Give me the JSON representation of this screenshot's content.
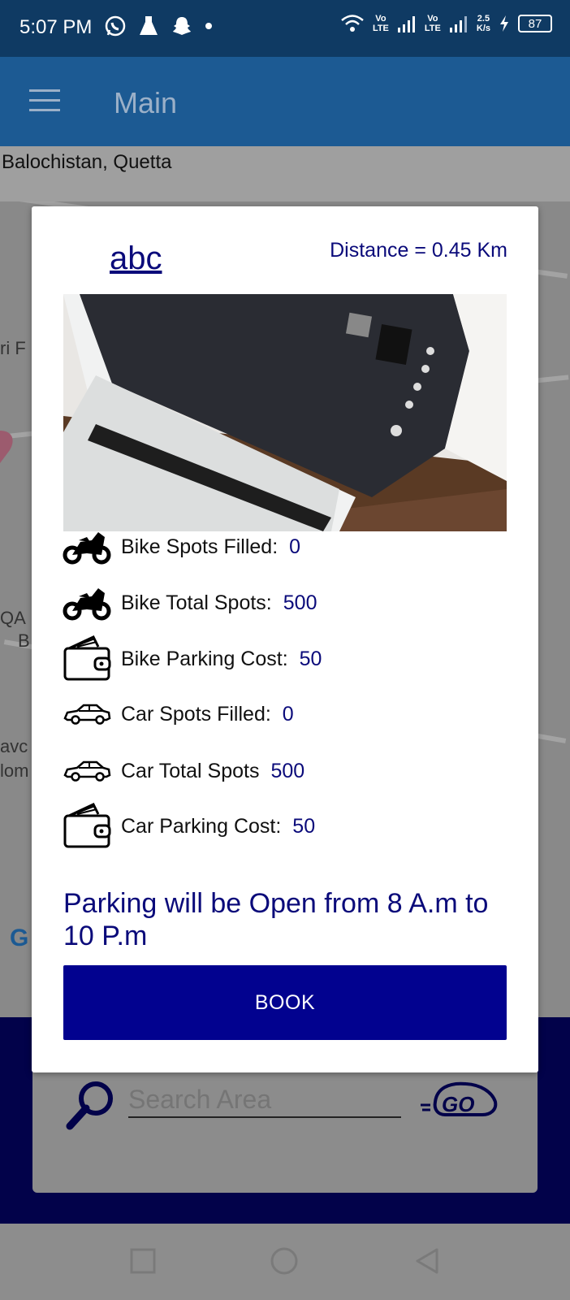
{
  "status_bar": {
    "time": "5:07 PM",
    "net_speed_top": "2.5",
    "net_speed_bottom": "K/s",
    "volte_1": "Vo\nLTE",
    "volte_2": "Vo\nLTE",
    "battery": "87"
  },
  "app_bar": {
    "title": "Main"
  },
  "location": {
    "text": "Balochistan, Quetta"
  },
  "map": {
    "fragments": [
      "ri F",
      "QA",
      "B",
      "avc",
      "lom"
    ]
  },
  "modal": {
    "place_name": "abc",
    "distance": "Distance = 0.45 Km",
    "rows": [
      {
        "icon": "motorbike-icon",
        "label": "Bike Spots Filled:",
        "value": "0"
      },
      {
        "icon": "motorbike-icon",
        "label": "Bike Total Spots:",
        "value": "500"
      },
      {
        "icon": "wallet-icon",
        "label": "Bike Parking Cost:",
        "value": "50"
      },
      {
        "icon": "car-icon",
        "label": "Car Spots Filled:",
        "value": "0"
      },
      {
        "icon": "car-icon",
        "label": "Car Total Spots",
        "value": "500"
      },
      {
        "icon": "wallet-icon",
        "label": "Car Parking Cost:",
        "value": "50"
      }
    ],
    "open_hours": "Parking will be Open from 8 A.m to 10 P.m",
    "book_label": "BOOK"
  },
  "search": {
    "placeholder": "Search Area",
    "go_label": "GO"
  },
  "colors": {
    "accent": "#02028f",
    "text_blue": "#0a0a7a",
    "app_bar": "#1c5a93",
    "status_bar": "#0f3a63"
  }
}
